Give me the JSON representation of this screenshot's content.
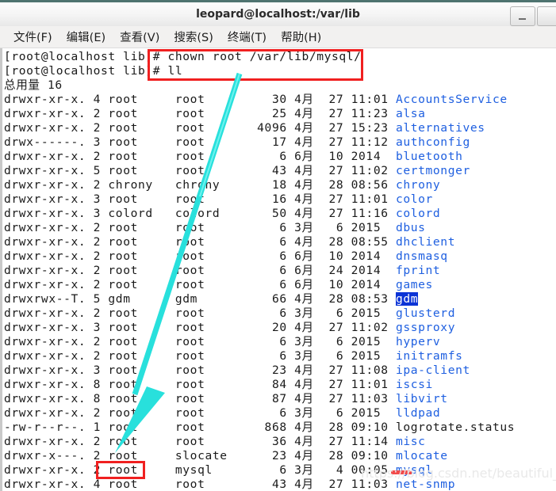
{
  "window": {
    "title": "leopard@localhost:/var/lib",
    "minimize_label": "_",
    "maximize_label": ""
  },
  "menubar": {
    "items": [
      {
        "label": "文件(F)",
        "name": "menu-file"
      },
      {
        "label": "编辑(E)",
        "name": "menu-edit"
      },
      {
        "label": "查看(V)",
        "name": "menu-view"
      },
      {
        "label": "搜索(S)",
        "name": "menu-search"
      },
      {
        "label": "终端(T)",
        "name": "menu-terminal"
      },
      {
        "label": "帮助(H)",
        "name": "menu-help"
      }
    ]
  },
  "terminal": {
    "prompt": "[root@localhost lib]#",
    "command_1": "chown root /var/lib/mysql/",
    "command_2": "ll",
    "total_line": "总用量 16",
    "rows": [
      {
        "perms": "drwxr-xr-x.",
        "links": "4",
        "owner": "root",
        "group": "root",
        "size": "30",
        "month": "4月",
        "day": "27",
        "time": "11:01",
        "name": "AccountsService",
        "kind": "dir"
      },
      {
        "perms": "drwxr-xr-x.",
        "links": "2",
        "owner": "root",
        "group": "root",
        "size": "25",
        "month": "4月",
        "day": "27",
        "time": "11:23",
        "name": "alsa",
        "kind": "dir"
      },
      {
        "perms": "drwxr-xr-x.",
        "links": "2",
        "owner": "root",
        "group": "root",
        "size": "4096",
        "month": "4月",
        "day": "27",
        "time": "15:23",
        "name": "alternatives",
        "kind": "dir"
      },
      {
        "perms": "drwx------.",
        "links": "3",
        "owner": "root",
        "group": "root",
        "size": "17",
        "month": "4月",
        "day": "27",
        "time": "11:12",
        "name": "authconfig",
        "kind": "dir"
      },
      {
        "perms": "drwxr-xr-x.",
        "links": "2",
        "owner": "root",
        "group": "root",
        "size": "6",
        "month": "6月",
        "day": "10",
        "time": "2014",
        "name": "bluetooth",
        "kind": "dir"
      },
      {
        "perms": "drwxr-xr-x.",
        "links": "5",
        "owner": "root",
        "group": "root",
        "size": "43",
        "month": "4月",
        "day": "27",
        "time": "11:02",
        "name": "certmonger",
        "kind": "dir"
      },
      {
        "perms": "drwxr-xr-x.",
        "links": "2",
        "owner": "chrony",
        "group": "chrony",
        "size": "18",
        "month": "4月",
        "day": "28",
        "time": "08:56",
        "name": "chrony",
        "kind": "dir"
      },
      {
        "perms": "drwxr-xr-x.",
        "links": "3",
        "owner": "root",
        "group": "root",
        "size": "16",
        "month": "4月",
        "day": "27",
        "time": "11:01",
        "name": "color",
        "kind": "dir"
      },
      {
        "perms": "drwxr-xr-x.",
        "links": "3",
        "owner": "colord",
        "group": "colord",
        "size": "50",
        "month": "4月",
        "day": "27",
        "time": "11:16",
        "name": "colord",
        "kind": "dir"
      },
      {
        "perms": "drwxr-xr-x.",
        "links": "2",
        "owner": "root",
        "group": "root",
        "size": "6",
        "month": "3月",
        "day": "6",
        "time": "2015",
        "name": "dbus",
        "kind": "dir"
      },
      {
        "perms": "drwxr-xr-x.",
        "links": "2",
        "owner": "root",
        "group": "root",
        "size": "6",
        "month": "4月",
        "day": "28",
        "time": "08:55",
        "name": "dhclient",
        "kind": "dir"
      },
      {
        "perms": "drwxr-xr-x.",
        "links": "2",
        "owner": "root",
        "group": "root",
        "size": "6",
        "month": "6月",
        "day": "10",
        "time": "2014",
        "name": "dnsmasq",
        "kind": "dir"
      },
      {
        "perms": "drwxr-xr-x.",
        "links": "2",
        "owner": "root",
        "group": "root",
        "size": "6",
        "month": "6月",
        "day": "24",
        "time": "2014",
        "name": "fprint",
        "kind": "dir"
      },
      {
        "perms": "drwxr-xr-x.",
        "links": "2",
        "owner": "root",
        "group": "root",
        "size": "6",
        "month": "6月",
        "day": "10",
        "time": "2014",
        "name": "games",
        "kind": "dir"
      },
      {
        "perms": "drwxrwx--T.",
        "links": "5",
        "owner": "gdm",
        "group": "gdm",
        "size": "66",
        "month": "4月",
        "day": "28",
        "time": "08:53",
        "name": "gdm",
        "kind": "dir-selected"
      },
      {
        "perms": "drwxr-xr-x.",
        "links": "2",
        "owner": "root",
        "group": "root",
        "size": "6",
        "month": "3月",
        "day": "6",
        "time": "2015",
        "name": "glusterd",
        "kind": "dir"
      },
      {
        "perms": "drwxr-xr-x.",
        "links": "3",
        "owner": "root",
        "group": "root",
        "size": "20",
        "month": "4月",
        "day": "27",
        "time": "11:02",
        "name": "gssproxy",
        "kind": "dir"
      },
      {
        "perms": "drwxr-xr-x.",
        "links": "2",
        "owner": "root",
        "group": "root",
        "size": "6",
        "month": "3月",
        "day": "6",
        "time": "2015",
        "name": "hyperv",
        "kind": "dir"
      },
      {
        "perms": "drwxr-xr-x.",
        "links": "2",
        "owner": "root",
        "group": "root",
        "size": "6",
        "month": "3月",
        "day": "6",
        "time": "2015",
        "name": "initramfs",
        "kind": "dir"
      },
      {
        "perms": "drwxr-xr-x.",
        "links": "3",
        "owner": "root",
        "group": "root",
        "size": "23",
        "month": "4月",
        "day": "27",
        "time": "11:08",
        "name": "ipa-client",
        "kind": "dir"
      },
      {
        "perms": "drwxr-xr-x.",
        "links": "8",
        "owner": "root",
        "group": "root",
        "size": "84",
        "month": "4月",
        "day": "27",
        "time": "11:01",
        "name": "iscsi",
        "kind": "dir"
      },
      {
        "perms": "drwxr-xr-x.",
        "links": "8",
        "owner": "root",
        "group": "root",
        "size": "87",
        "month": "4月",
        "day": "27",
        "time": "11:03",
        "name": "libvirt",
        "kind": "dir"
      },
      {
        "perms": "drwxr-xr-x.",
        "links": "2",
        "owner": "root",
        "group": "root",
        "size": "6",
        "month": "3月",
        "day": "6",
        "time": "2015",
        "name": "lldpad",
        "kind": "dir"
      },
      {
        "perms": "-rw-r--r--.",
        "links": "1",
        "owner": "root",
        "group": "root",
        "size": "868",
        "month": "4月",
        "day": "28",
        "time": "09:10",
        "name": "logrotate.status",
        "kind": "file"
      },
      {
        "perms": "drwxr-xr-x.",
        "links": "2",
        "owner": "root",
        "group": "root",
        "size": "36",
        "month": "4月",
        "day": "27",
        "time": "11:14",
        "name": "misc",
        "kind": "dir"
      },
      {
        "perms": "drwxr-x---.",
        "links": "2",
        "owner": "root",
        "group": "slocate",
        "size": "23",
        "month": "4月",
        "day": "28",
        "time": "09:10",
        "name": "mlocate",
        "kind": "dir"
      },
      {
        "perms": "drwxr-xr-x.",
        "links": "2",
        "owner": "root",
        "group": "mysql",
        "size": "6",
        "month": "3月",
        "day": "4",
        "time": "00:05",
        "name": "mysql",
        "kind": "dir"
      },
      {
        "perms": "drwxr-xr-x.",
        "links": "4",
        "owner": "root",
        "group": "root",
        "size": "43",
        "month": "4月",
        "day": "27",
        "time": "11:03",
        "name": "net-snmp",
        "kind": "dir"
      }
    ]
  },
  "annotations": {
    "watermark": "https://blog.csdn.net/beautiful_huang",
    "red_color": "#f02020",
    "arrow_color": "#28e0dc",
    "highlight_color": "#0b33d6",
    "dir_color": "#1e5fe0"
  }
}
